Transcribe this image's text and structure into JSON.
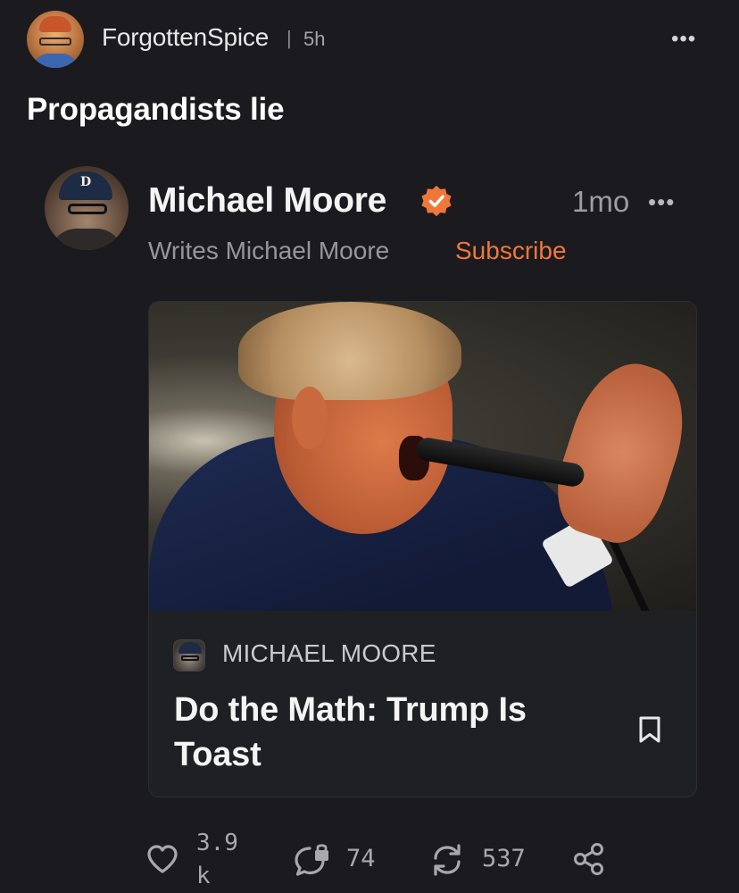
{
  "note": {
    "author": "ForgottenSpice",
    "separator": "|",
    "time": "5h",
    "more": "•••",
    "text": "Propagandists lie"
  },
  "embedded_note": {
    "author": "Michael Moore",
    "verified": true,
    "time": "1mo",
    "more": "•••",
    "byline": "Writes Michael Moore",
    "subscribe_label": "Subscribe",
    "accent_color": "#f0773a"
  },
  "article_card": {
    "publication": "MICHAEL MOORE",
    "title": "Do the Math: Trump Is Toast"
  },
  "actions": {
    "likes": "3.9k",
    "comments": "74",
    "restacks": "537"
  },
  "icons": [
    "more-icon",
    "verified-icon",
    "bookmark-icon",
    "heart-icon",
    "comment-icon",
    "restack-icon",
    "share-icon"
  ]
}
